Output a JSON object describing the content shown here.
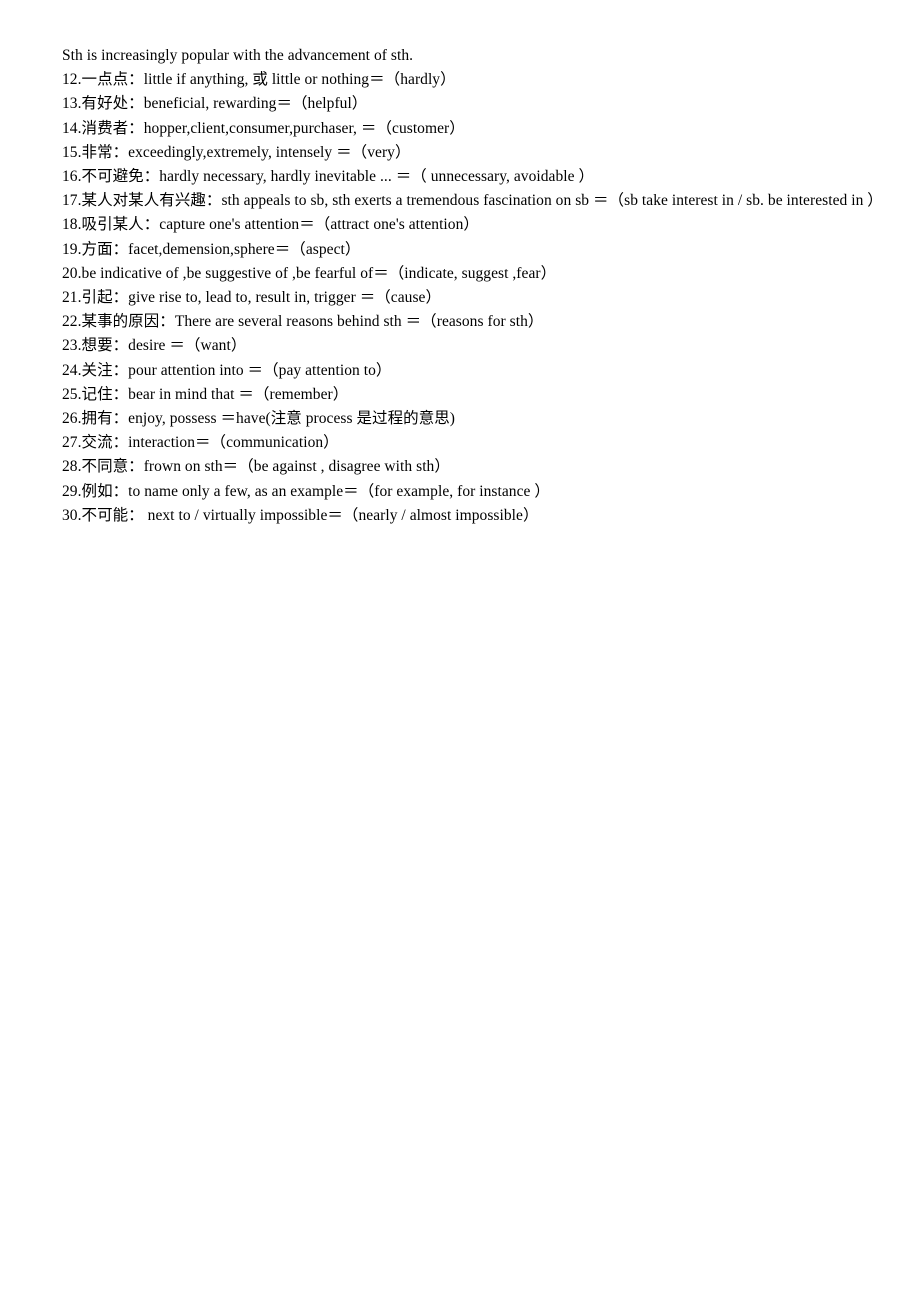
{
  "document": {
    "title": "English Synonym Upgrade Vocabulary List",
    "page_background": "#ffffff",
    "text_color": "#000000",
    "lines": [
      {
        "id": "intro",
        "text": "Sth is increasingly popular with the advancement of sth."
      },
      {
        "id": "item-12",
        "text": "12.一点点：little if anything, 或 little or nothing＝（hardly）"
      },
      {
        "id": "item-13",
        "text": "13.有好处：beneficial, rewarding＝（helpful）"
      },
      {
        "id": "item-14",
        "text": "14.消费者：hopper,client,consumer,purchaser, ＝（customer）"
      },
      {
        "id": "item-15",
        "text": "15.非常：exceedingly,extremely, intensely ＝（very）"
      },
      {
        "id": "item-16",
        "text": "16.不可避免：hardly necessary, hardly inevitable ... ＝（ unnecessary, avoidable ）"
      },
      {
        "id": "item-17",
        "text": "17.某人对某人有兴趣：sth appeals to sb, sth exerts a tremendous fascination on sb ＝（sb take interest in / sb. be interested in ）"
      },
      {
        "id": "item-18",
        "text": "18.吸引某人：capture one's attention＝（attract one's attention）"
      },
      {
        "id": "item-19",
        "text": "19.方面：facet,demension,sphere＝（aspect）"
      },
      {
        "id": "item-20",
        "text": "20.be indicative of ,be suggestive of ,be fearful of＝（indicate, suggest ,fear）"
      },
      {
        "id": "item-21",
        "text": "21.引起：give rise to, lead to, result in, trigger ＝（cause）"
      },
      {
        "id": "item-22",
        "text": "22.某事的原因：There are several reasons behind sth ＝（reasons for sth）"
      },
      {
        "id": "item-23",
        "text": "23.想要：desire ＝（want）"
      },
      {
        "id": "item-24",
        "text": "24.关注：pour attention into ＝（pay attention to）"
      },
      {
        "id": "item-25",
        "text": "25.记住：bear in mind that ＝（remember）"
      },
      {
        "id": "item-26",
        "text": "26.拥有：enjoy, possess ＝have(注意 process 是过程的意思)"
      },
      {
        "id": "item-27",
        "text": "27.交流：interaction＝（communication）"
      },
      {
        "id": "item-28",
        "text": "28.不同意：frown on sth＝（be against , disagree with sth）"
      },
      {
        "id": "item-29",
        "text": "29.例如：to name only a few, as an example＝（for example, for instance ）"
      },
      {
        "id": "item-30",
        "text": "30.不可能： next to / virtually impossible＝（nearly / almost impossible）"
      }
    ]
  }
}
